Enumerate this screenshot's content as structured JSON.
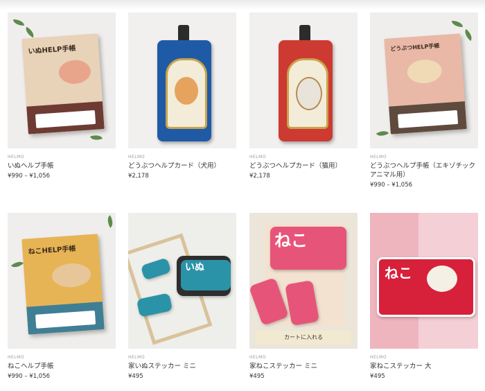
{
  "products": [
    {
      "brand": "HELMO",
      "name": "いぬヘルプ手帳",
      "price": "¥990 – ¥1,056",
      "cover": "いぬHELP手帳"
    },
    {
      "brand": "HELMO",
      "name": "どうぶつヘルプカード（犬用）",
      "price": "¥2,178"
    },
    {
      "brand": "HELMO",
      "name": "どうぶつヘルプカード（猫用）",
      "price": "¥2,178"
    },
    {
      "brand": "HELMO",
      "name": "どうぶつヘルプ手帳（エキゾチック",
      "name2": "アニマル用）",
      "price": "¥990 – ¥1,056",
      "cover": "どうぶつHELP手帳"
    },
    {
      "brand": "HELMO",
      "name": "ねこヘルプ手帳",
      "price": "¥990 – ¥1,056",
      "cover": "ねこHELP手帳"
    },
    {
      "brand": "HELMO",
      "name": "家いぬステッカー ミニ",
      "price": "¥495",
      "sticker": "いぬ"
    },
    {
      "brand": "HELMO",
      "name": "家ねこステッカー ミニ",
      "price": "¥495",
      "sticker": "ねこ",
      "overlay_button": "カートに入れる"
    },
    {
      "brand": "HELMO",
      "name": "家ねこステッカー 大",
      "price": "¥495",
      "sticker": "ねこ"
    }
  ],
  "colors": {
    "dog_book": "#e8d2b8",
    "dog_band": "#6e3b33",
    "cat_book": "#e7b455",
    "cat_band": "#3f7f96",
    "exotic_book": "#e9b8a6",
    "exotic_band": "#5f4a3e",
    "dog_tag": "#1f5aa6",
    "cat_tag": "#cc3a32",
    "sticker_red": "#d7203a"
  }
}
